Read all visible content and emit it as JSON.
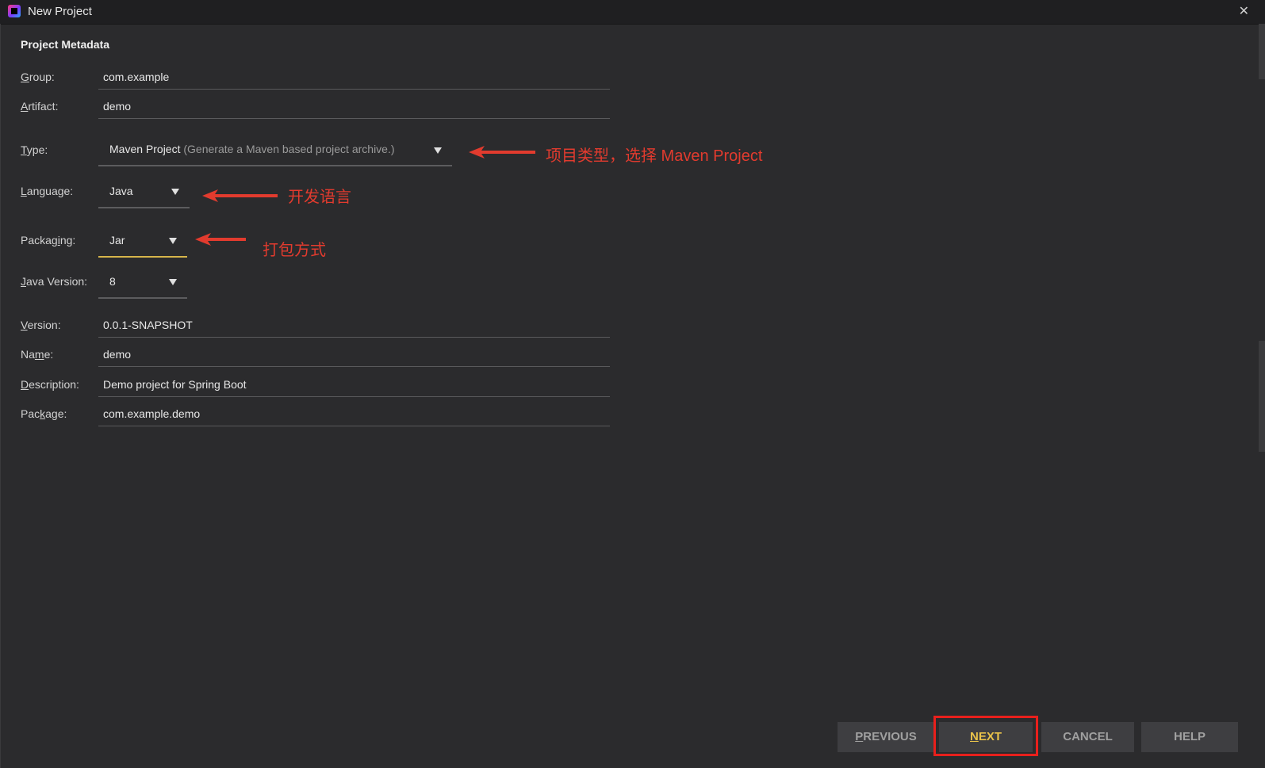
{
  "window": {
    "title": "New Project",
    "close_label": "✕"
  },
  "section_title": "Project Metadata",
  "fields": {
    "group": {
      "label_prefix": "",
      "label_accel": "G",
      "label_rest": "roup:",
      "value": "com.example"
    },
    "artifact": {
      "label_prefix": "",
      "label_accel": "A",
      "label_rest": "rtifact:",
      "value": "demo"
    },
    "version": {
      "label_prefix": "",
      "label_accel": "V",
      "label_rest": "ersion:",
      "value": "0.0.1-SNAPSHOT"
    },
    "name": {
      "label_prefix": "Na",
      "label_accel": "m",
      "label_rest": "e:",
      "value": "demo"
    },
    "description": {
      "label_prefix": "",
      "label_accel": "D",
      "label_rest": "escription:",
      "value": "Demo project for Spring Boot"
    },
    "package": {
      "label_prefix": "Pac",
      "label_accel": "k",
      "label_rest": "age:",
      "value": "com.example.demo"
    }
  },
  "combos": {
    "type": {
      "label_prefix": "",
      "label_accel": "T",
      "label_rest": "ype:",
      "value": "Maven Project",
      "hint": "(Generate a Maven based project archive.)"
    },
    "language": {
      "label_prefix": "",
      "label_accel": "L",
      "label_rest": "anguage:",
      "value": "Java"
    },
    "packaging": {
      "label_prefix": "Packag",
      "label_accel": "i",
      "label_rest": "ng:",
      "value": "Jar"
    },
    "java_version": {
      "label_prefix": "",
      "label_accel": "J",
      "label_rest": "ava Version:",
      "value": "8"
    }
  },
  "annotations": {
    "type": "项目类型，选择 Maven Project",
    "language": "开发语言",
    "packaging": "打包方式"
  },
  "buttons": {
    "previous": {
      "accel": "P",
      "rest": "REVIOUS"
    },
    "next": {
      "accel": "N",
      "rest": "EXT"
    },
    "cancel": {
      "label": "CANCEL"
    },
    "help": {
      "label": "HELP"
    }
  },
  "colors": {
    "annotation": "#e23b2e",
    "accent": "#e8c24a",
    "highlight": "#e8201c"
  }
}
